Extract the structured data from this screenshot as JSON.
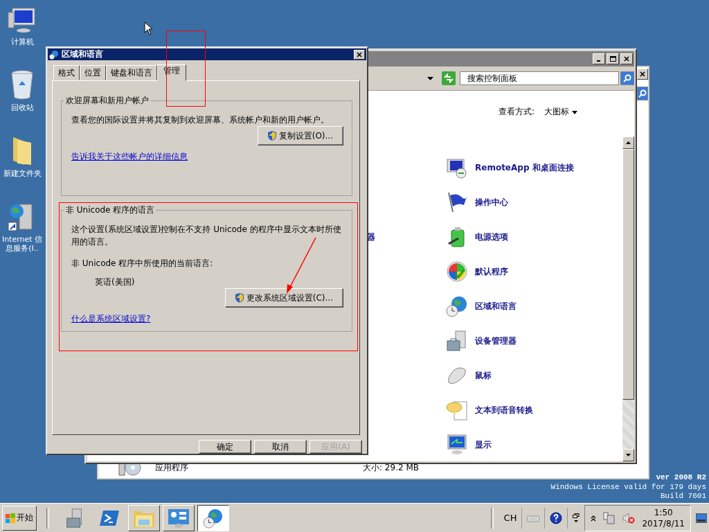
{
  "desktop_icons": [
    {
      "label": "计算机",
      "kind": "computer"
    },
    {
      "label": "回收站",
      "kind": "recycle-bin"
    },
    {
      "label": "新建文件夹",
      "kind": "folder"
    },
    {
      "label": "Internet 信息服务(I..",
      "kind": "server"
    }
  ],
  "background_window": {
    "item_label": "应用程序",
    "item_size": "大小: 29.2 MB"
  },
  "control_panel": {
    "search": {
      "placeholder": "搜索控制面板"
    },
    "view_label": "查看方式:",
    "view_value": "大图标",
    "partial_item": "器",
    "items": [
      {
        "label": "RemoteApp 和桌面连接",
        "kind": "remote"
      },
      {
        "label": "操作中心",
        "kind": "flag"
      },
      {
        "label": "电源选项",
        "kind": "battery"
      },
      {
        "label": "默认程序",
        "kind": "windows"
      },
      {
        "label": "区域和语言",
        "kind": "globe"
      },
      {
        "label": "设备管理器",
        "kind": "toolbox"
      },
      {
        "label": "鼠标",
        "kind": "mouse"
      },
      {
        "label": "文本到语音转换",
        "kind": "speech"
      },
      {
        "label": "显示",
        "kind": "display"
      }
    ]
  },
  "dialog": {
    "title": "区域和语言",
    "tabs": [
      {
        "label": "格式",
        "selected": false
      },
      {
        "label": "位置",
        "selected": false
      },
      {
        "label": "键盘和语言",
        "selected": false
      },
      {
        "label": "管理",
        "selected": true
      }
    ],
    "groups": [
      {
        "title": "欢迎屏幕和新用户帐户",
        "description": "查看您的国际设置并将其复制到欢迎屏幕、系统帐户和新的用户帐户。",
        "button": "复制设置(O)...",
        "link": "告诉我关于这些帐户的详细信息"
      },
      {
        "title": "非 Unicode 程序的语言",
        "description": "这个设置(系统区域设置)控制在不支持 Unicode 的程序中显示文本时所使用的语言。",
        "current_label": "非 Unicode 程序中所使用的当前语言:",
        "current_value": "英语(美国)",
        "button": "更改系统区域设置(C)...",
        "link": "什么是系统区域设置?"
      }
    ],
    "buttons": [
      {
        "label": "确定",
        "disabled": false
      },
      {
        "label": "取消",
        "disabled": false
      },
      {
        "label": "应用(A)",
        "disabled": true
      }
    ]
  },
  "desktop_text": [
    {
      "text": "ver 2008 R2",
      "bold": true
    },
    {
      "text": "Windows License valid for 179 days",
      "bold": false
    },
    {
      "text": "Build 7601",
      "bold": false
    }
  ],
  "taskbar": {
    "start": "开始",
    "apps": [
      {
        "kind": "server-manager",
        "open": false,
        "selected": false
      },
      {
        "kind": "powershell",
        "open": false,
        "selected": false
      },
      {
        "kind": "explorer",
        "open": true,
        "selected": false
      },
      {
        "kind": "control-panel",
        "open": true,
        "selected": false
      },
      {
        "kind": "region",
        "open": true,
        "selected": true
      }
    ],
    "language": "CH",
    "time": "1:50",
    "date": "2017/8/11"
  }
}
